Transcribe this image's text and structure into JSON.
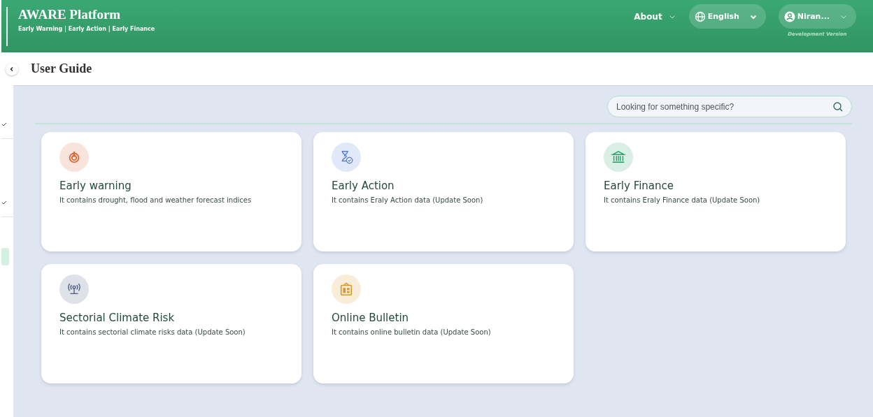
{
  "header": {
    "title": "AWARE Platform",
    "subtitle": "Early Warning | Early Action | Early Finance",
    "nav": [
      {
        "label": "About"
      }
    ],
    "language": {
      "label": "English"
    },
    "user": {
      "label": "Niran...",
      "note": "Development Version"
    }
  },
  "page": {
    "title": "User Guide"
  },
  "search": {
    "placeholder": "Looking for something specific?"
  },
  "cards": [
    {
      "kind": "warning",
      "color": "#d9693a",
      "title": "Early warning",
      "description": "It contains drought, flood and weather forecast indices"
    },
    {
      "kind": "action",
      "color": "#5a7fd0",
      "title": "Early Action",
      "description": "It contains Eraly Action data (Update Soon)"
    },
    {
      "kind": "finance",
      "color": "#2e9e6a",
      "title": "Early Finance",
      "description": "It contains Eraly Finance data (Update Soon)"
    },
    {
      "kind": "risk",
      "color": "#4a5a80",
      "title": "Sectorial Climate Risk",
      "description": "It contains sectorial climate risks data (Update Soon)"
    },
    {
      "kind": "bulletin",
      "color": "#d69a2c",
      "title": "Online Bulletin",
      "description": "It contains online bulletin data (Update Soon)"
    }
  ]
}
